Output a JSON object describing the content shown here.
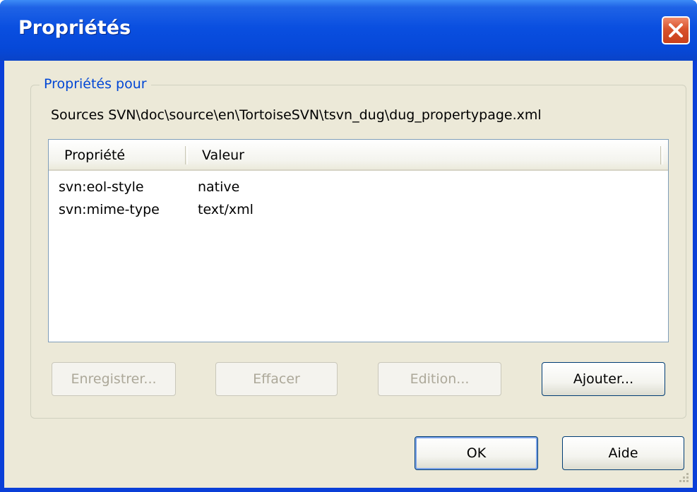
{
  "window": {
    "title": "Propriétés"
  },
  "group": {
    "label": "Propriétés pour",
    "path": "Sources SVN\\doc\\source\\en\\TortoiseSVN\\tsvn_dug\\dug_propertypage.xml"
  },
  "list": {
    "columns": [
      "Propriété",
      "Valeur"
    ],
    "rows": [
      {
        "property": "svn:eol-style",
        "value": "native"
      },
      {
        "property": "svn:mime-type",
        "value": "text/xml"
      }
    ]
  },
  "buttons": {
    "save": "Enregistrer...",
    "remove": "Effacer",
    "edit": "Edition...",
    "add": "Ajouter...",
    "ok": "OK",
    "help": "Aide"
  },
  "colors": {
    "titlebar": "#0a4fe0",
    "client_bg": "#ece9d8",
    "group_label": "#0046d5",
    "close": "#d8522c"
  }
}
